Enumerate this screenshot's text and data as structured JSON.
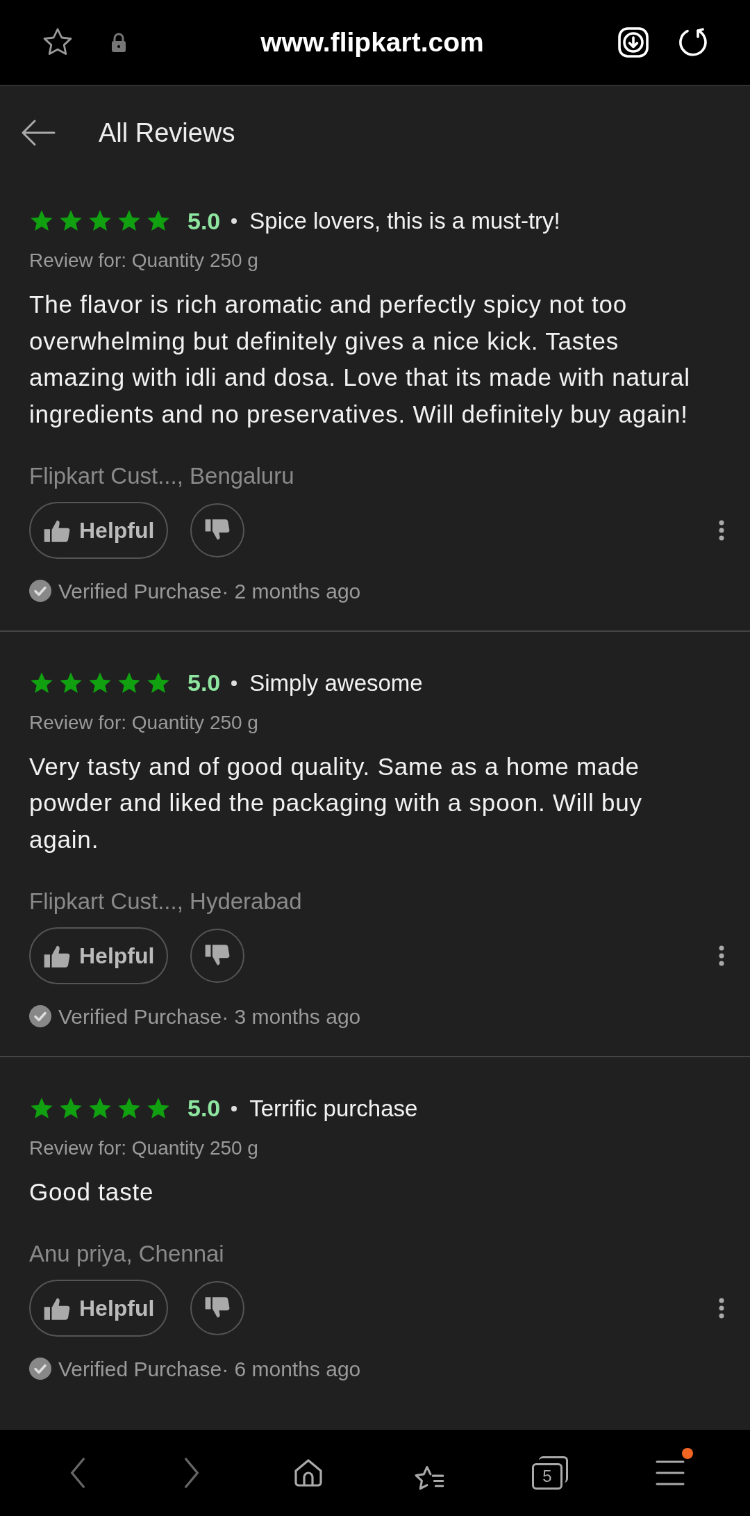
{
  "browser_bar": {
    "url": "www.flipkart.com"
  },
  "header": {
    "title": "All Reviews"
  },
  "reviews": [
    {
      "stars": 5,
      "rating": "5.0",
      "title": "Spice lovers, this is a must-try!",
      "variant": "Review for: Quantity 250 g",
      "body": "The flavor is rich aromatic and perfectly spicy not too overwhelming but definitely gives a nice kick. Tastes amazing with idli and dosa. Love that its made with natural ingredients and no preservatives. Will definitely buy again!",
      "author": "Flipkart Cust..., Bengaluru",
      "helpful_label": "Helpful",
      "verified": "Verified Purchase· 2 months ago"
    },
    {
      "stars": 5,
      "rating": "5.0",
      "title": "Simply awesome",
      "variant": "Review for: Quantity 250 g",
      "body": "Very tasty and of good quality. Same as a home made powder and liked the packaging with a spoon. Will buy again.",
      "author": "Flipkart Cust..., Hyderabad",
      "helpful_label": "Helpful",
      "verified": "Verified Purchase· 3 months ago"
    },
    {
      "stars": 5,
      "rating": "5.0",
      "title": "Terrific purchase",
      "variant": "Review for: Quantity 250 g",
      "body": "Good taste",
      "author": "Anu priya, Chennai",
      "helpful_label": "Helpful",
      "verified": "Verified Purchase· 6 months ago"
    }
  ],
  "bottom_nav": {
    "tab_count": "5",
    "menu_notification": true
  }
}
